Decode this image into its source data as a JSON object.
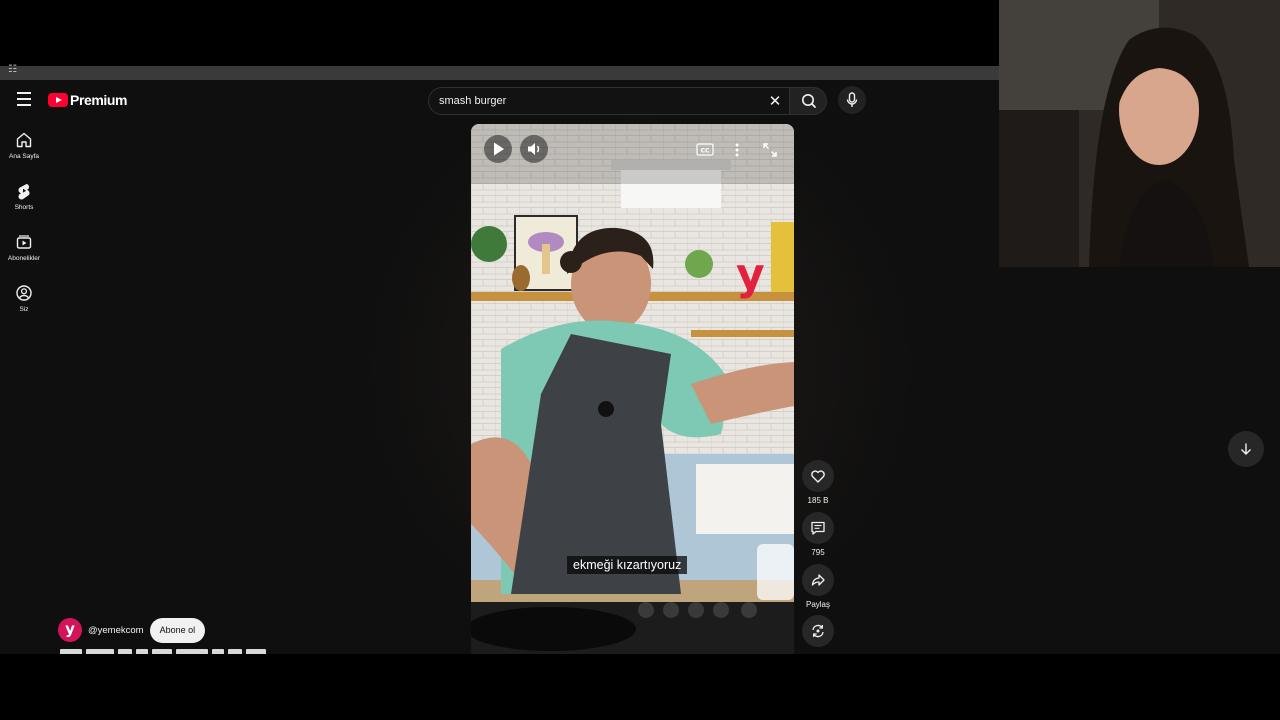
{
  "header": {
    "brand": "Premium",
    "search_value": "smash burger"
  },
  "sidebar": {
    "items": [
      {
        "label": "Ana Sayfa",
        "icon": "home-icon"
      },
      {
        "label": "Shorts",
        "icon": "shorts-icon"
      },
      {
        "label": "Abonelikler",
        "icon": "subscriptions-icon"
      },
      {
        "label": "Siz",
        "icon": "account-icon"
      }
    ]
  },
  "video": {
    "caption": "ekmeği kızartıyoruz"
  },
  "actions": {
    "like_count": "185 B",
    "comment_count": "795",
    "share_label": "Paylaş"
  },
  "channel": {
    "handle": "@yemekcom",
    "avatar_letter": "y",
    "subscribe_label": "Abone ol"
  },
  "colors": {
    "brand_red": "#ff0033",
    "background": "#0f0f0f",
    "channel_avatar": "#d3145a"
  }
}
